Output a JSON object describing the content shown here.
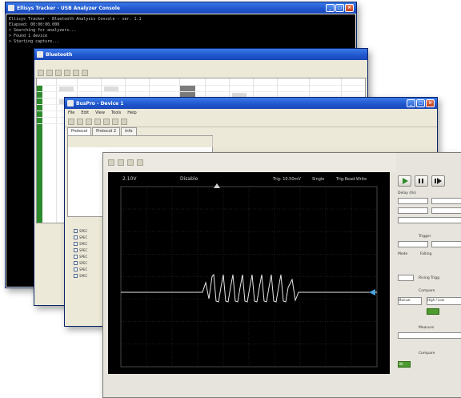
{
  "console_window": {
    "title": "Ellisys Tracker - USB Analyzer Console",
    "lines": [
      "Ellisys Tracker - Bluetooth Analysis Console - ver. 1.1",
      "Elapsed: 00:00:00.000",
      "",
      "> Searching for analyzers...",
      "> Found 1 device",
      "> Starting capture..."
    ]
  },
  "table_window": {
    "title": "Bluetooth"
  },
  "form_window": {
    "title": "BusPro - Device 1",
    "menu": [
      "File",
      "Edit",
      "View",
      "Tools",
      "Help"
    ],
    "tabs": [
      "Protocol",
      "Protocol 2",
      "Info"
    ],
    "checks": [
      "SPEC",
      "SPEC",
      "SPEC",
      "SPEC",
      "SPEC",
      "SPEC",
      "SPEC",
      "SPEC"
    ]
  },
  "scope_window": {
    "readout_left": "2.10V",
    "readout_mid": "Disable",
    "readout_right_a": "Trig: 10.50mV",
    "readout_right_b": "Single",
    "readout_right_c": "Trig:Read:Write",
    "right_panel": {
      "group1": "Delay (0s)",
      "group2": "Trigger",
      "mode_label": "Mode",
      "trigger_label": "Falling",
      "rate_label": "Rising Trigg",
      "section3": "Compare",
      "section4": "Measure",
      "section5": "Compare",
      "btn_left": "Manual",
      "btn_right": "High / Low",
      "ok_label": "OK"
    }
  },
  "colors": {
    "xp_title_blue": "#1f55cc",
    "console_bg": "#000000",
    "scope_trace": "#e6e6e6",
    "scope_grid": "#3c3c3c",
    "grid_green": "#2c8a2c"
  }
}
